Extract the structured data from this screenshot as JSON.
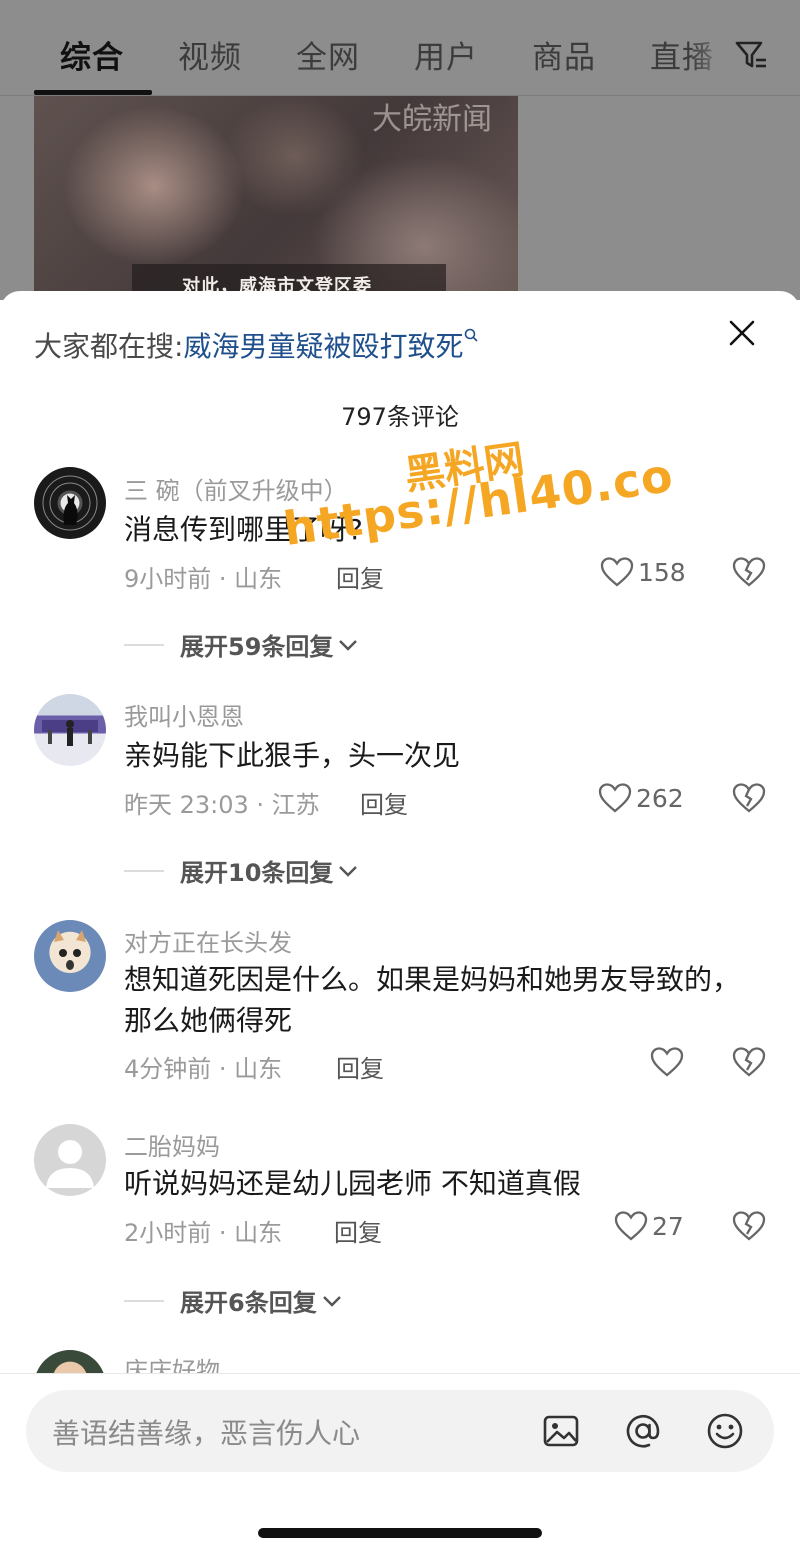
{
  "tabs": [
    "综合",
    "视频",
    "全网",
    "用户",
    "商品",
    "直播"
  ],
  "active_tab": 0,
  "video": {
    "watermark": "大皖新闻",
    "caption": "对此，威海市文登区委"
  },
  "trending": {
    "label": "大家都在搜:",
    "query": "威海男童疑被殴打致死"
  },
  "comment_count": "797条评论",
  "comments": [
    {
      "username": "三 碗（前叉升级中）",
      "text": "消息传到哪里了呀?",
      "time": "9小时前 · 山东",
      "reply": "回复",
      "likes": "158",
      "expand": "展开59条回复"
    },
    {
      "username": "我叫小恩恩",
      "text": "亲妈能下此狠手，头一次见",
      "time": "昨天 23:03 · 江苏",
      "reply": "回复",
      "likes": "262",
      "expand": "展开10条回复"
    },
    {
      "username": "对方正在长头发",
      "text": "想知道死因是什么。如果是妈妈和她男友导致的，那么她俩得死",
      "time": "4分钟前 · 山东",
      "reply": "回复",
      "likes": ""
    },
    {
      "username": "二胎妈妈",
      "text": "听说妈妈还是幼儿园老师 不知道真假",
      "time": "2小时前 · 山东",
      "reply": "回复",
      "likes": "27",
      "expand": "展开6条回复"
    },
    {
      "username": "庆庆好物"
    }
  ],
  "watermark": {
    "line1": "黑料网",
    "line2": "https://hl40.co"
  },
  "input": {
    "placeholder": "善语结善缘，恶言伤人心"
  },
  "colors": {
    "link": "#1f4f8c",
    "watermark": "#f5a623",
    "overlay": "#8d8d8d"
  }
}
